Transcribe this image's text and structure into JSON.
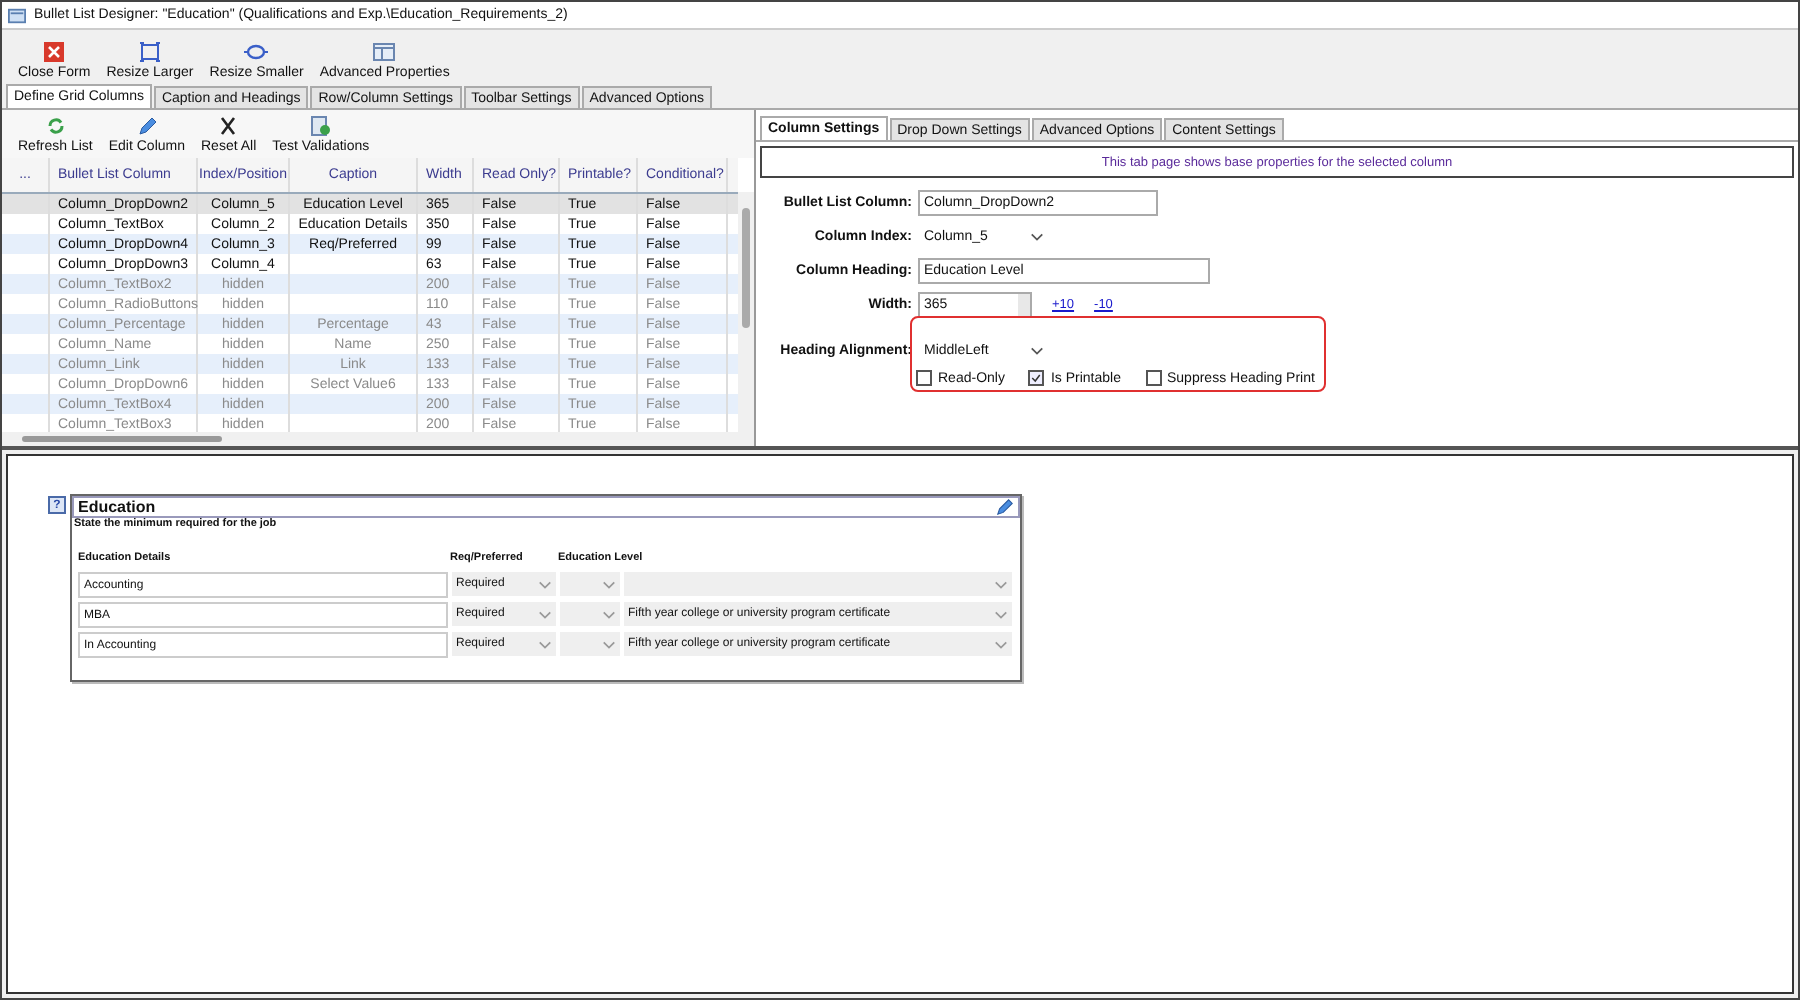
{
  "window": {
    "title": "Bullet List Designer: \"Education\" (Qualifications and Exp.\\Education_Requirements_2)"
  },
  "toolbar": [
    {
      "label": "Close Form",
      "kind": "close"
    },
    {
      "label": "Resize Larger",
      "kind": "larger"
    },
    {
      "label": "Resize Smaller",
      "kind": "smaller"
    },
    {
      "label": "Advanced Properties",
      "kind": "properties"
    }
  ],
  "tabs": [
    {
      "label": "Define Grid Columns",
      "selected": true
    },
    {
      "label": "Caption and Headings",
      "selected": false
    },
    {
      "label": "Row/Column Settings",
      "selected": false
    },
    {
      "label": "Toolbar Settings",
      "selected": false
    },
    {
      "label": "Advanced Options",
      "selected": false
    }
  ],
  "grid_toolbar": [
    {
      "label": "Refresh List",
      "kind": "refresh"
    },
    {
      "label": "Edit Column",
      "kind": "edit"
    },
    {
      "label": "Reset All",
      "kind": "reset"
    },
    {
      "label": "Test Validations",
      "kind": "test"
    }
  ],
  "grid": {
    "columns": [
      "...",
      "Bullet List Column",
      "Index/Position",
      "Caption",
      "Width",
      "Read Only?",
      "Printable?",
      "Conditional?"
    ],
    "rows": [
      {
        "cells": [
          "",
          "Column_DropDown2",
          "Column_5",
          "Education Level",
          "365",
          "False",
          "True",
          "False"
        ],
        "hidden": false,
        "selected": true
      },
      {
        "cells": [
          "",
          "Column_TextBox",
          "Column_2",
          "Education Details",
          "350",
          "False",
          "True",
          "False"
        ],
        "hidden": false,
        "selected": false
      },
      {
        "cells": [
          "",
          "Column_DropDown4",
          "Column_3",
          "Req/Preferred",
          "99",
          "False",
          "True",
          "False"
        ],
        "hidden": false,
        "selected": false
      },
      {
        "cells": [
          "",
          "Column_DropDown3",
          "Column_4",
          "",
          "63",
          "False",
          "True",
          "False"
        ],
        "hidden": false,
        "selected": false
      },
      {
        "cells": [
          "",
          "Column_TextBox2",
          "hidden",
          "",
          "200",
          "False",
          "True",
          "False"
        ],
        "hidden": true,
        "selected": false
      },
      {
        "cells": [
          "",
          "Column_RadioButtons",
          "hidden",
          "",
          "110",
          "False",
          "True",
          "False"
        ],
        "hidden": true,
        "selected": false
      },
      {
        "cells": [
          "",
          "Column_Percentage",
          "hidden",
          "Percentage",
          "43",
          "False",
          "True",
          "False"
        ],
        "hidden": true,
        "selected": false
      },
      {
        "cells": [
          "",
          "Column_Name",
          "hidden",
          "Name",
          "250",
          "False",
          "True",
          "False"
        ],
        "hidden": true,
        "selected": false
      },
      {
        "cells": [
          "",
          "Column_Link",
          "hidden",
          "Link",
          "133",
          "False",
          "True",
          "False"
        ],
        "hidden": true,
        "selected": false
      },
      {
        "cells": [
          "",
          "Column_DropDown6",
          "hidden",
          "Select Value6",
          "133",
          "False",
          "True",
          "False"
        ],
        "hidden": true,
        "selected": false
      },
      {
        "cells": [
          "",
          "Column_TextBox4",
          "hidden",
          "",
          "200",
          "False",
          "True",
          "False"
        ],
        "hidden": true,
        "selected": false
      },
      {
        "cells": [
          "",
          "Column_TextBox3",
          "hidden",
          "",
          "200",
          "False",
          "True",
          "False"
        ],
        "hidden": true,
        "selected": false
      }
    ]
  },
  "settings_tabs": [
    {
      "label": "Column Settings",
      "selected": true
    },
    {
      "label": "Drop Down Settings",
      "selected": false
    },
    {
      "label": "Advanced Options",
      "selected": false
    },
    {
      "label": "Content Settings",
      "selected": false
    }
  ],
  "settings": {
    "info": "This tab page shows base properties for the selected column",
    "bullet_list_column": {
      "label": "Bullet List Column:",
      "value": "Column_DropDown2"
    },
    "column_index": {
      "label": "Column Index:",
      "value": "Column_5"
    },
    "column_heading": {
      "label": "Column Heading:",
      "value": "Education Level"
    },
    "width": {
      "label": "Width:",
      "value": "365",
      "plus": "+10",
      "minus": "-10"
    },
    "heading_alignment": {
      "label": "Heading Alignment:",
      "value": "MiddleLeft"
    },
    "checkboxes": [
      {
        "label": "Read-Only",
        "checked": false
      },
      {
        "label": "Is Printable",
        "checked": true
      },
      {
        "label": "Suppress Heading Print",
        "checked": false
      }
    ]
  },
  "preview": {
    "help": "?",
    "title": "Education",
    "subtitle": "State the minimum required for the job",
    "headers": [
      "Education Details",
      "Req/Preferred",
      "Education Level"
    ],
    "rows": [
      {
        "detail": "Accounting",
        "req": "Required",
        "level": ""
      },
      {
        "detail": "MBA",
        "req": "Required",
        "level": "Fifth year college or university program certificate"
      },
      {
        "detail": "In Accounting",
        "req": "Required",
        "level": "Fifth year college or university program certificate"
      }
    ]
  }
}
